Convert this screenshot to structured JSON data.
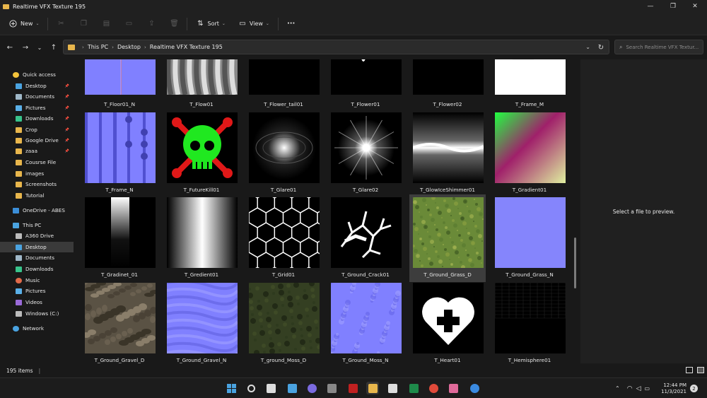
{
  "window": {
    "title": "Realtime VFX Texture 195",
    "minimize_glyph": "—",
    "maximize_glyph": "❐",
    "close_glyph": "✕"
  },
  "toolbar": {
    "new_label": "New",
    "sort_label": "Sort",
    "view_label": "View",
    "more_glyph": "···"
  },
  "address": {
    "crumbs": [
      "This PC",
      "Desktop",
      "Realtime VFX Texture 195"
    ],
    "search_placeholder": "Search Realtime VFX Textur..."
  },
  "sidebar": {
    "items": [
      {
        "label": "Quick access",
        "icon": "star-icon",
        "color": "#f3c33b",
        "pinned": false,
        "selected": false
      },
      {
        "label": "Desktop",
        "icon": "desktop-icon",
        "color": "#4aa3e0",
        "pinned": true,
        "selected": false
      },
      {
        "label": "Documents",
        "icon": "documents-icon",
        "color": "#9fb8c8",
        "pinned": true,
        "selected": false
      },
      {
        "label": "Pictures",
        "icon": "pictures-icon",
        "color": "#5ab0e8",
        "pinned": true,
        "selected": false
      },
      {
        "label": "Downloads",
        "icon": "downloads-icon",
        "color": "#38c38b",
        "pinned": true,
        "selected": false
      },
      {
        "label": "Crop",
        "icon": "folder-icon",
        "color": "#e8b64c",
        "pinned": true,
        "selected": false
      },
      {
        "label": "Google Drive",
        "icon": "folder-icon",
        "color": "#e8b64c",
        "pinned": true,
        "selected": false
      },
      {
        "label": "zaaa",
        "icon": "folder-icon",
        "color": "#e8b64c",
        "pinned": true,
        "selected": false
      },
      {
        "label": "Cousrse File",
        "icon": "folder-icon",
        "color": "#e8b64c",
        "pinned": false,
        "selected": false
      },
      {
        "label": "images",
        "icon": "folder-icon",
        "color": "#e8b64c",
        "pinned": false,
        "selected": false
      },
      {
        "label": "Screenshots",
        "icon": "folder-icon",
        "color": "#e8b64c",
        "pinned": false,
        "selected": false
      },
      {
        "label": "Tutorial",
        "icon": "folder-icon",
        "color": "#e8b64c",
        "pinned": false,
        "selected": false
      },
      {
        "label": "OneDrive - ABES",
        "icon": "onedrive-icon",
        "color": "#3b8ed8",
        "pinned": false,
        "selected": false
      },
      {
        "label": "This PC",
        "icon": "pc-icon",
        "color": "#4aa3e0",
        "pinned": false,
        "selected": false
      },
      {
        "label": "A360 Drive",
        "icon": "drive-icon",
        "color": "#bcbcbc",
        "pinned": false,
        "selected": false
      },
      {
        "label": "Desktop",
        "icon": "desktop-icon",
        "color": "#4aa3e0",
        "pinned": false,
        "selected": true
      },
      {
        "label": "Documents",
        "icon": "documents-icon",
        "color": "#9fb8c8",
        "pinned": false,
        "selected": false
      },
      {
        "label": "Downloads",
        "icon": "downloads-icon",
        "color": "#38c38b",
        "pinned": false,
        "selected": false
      },
      {
        "label": "Music",
        "icon": "music-icon",
        "color": "#e06a4a",
        "pinned": false,
        "selected": false
      },
      {
        "label": "Pictures",
        "icon": "pictures-icon",
        "color": "#5ab0e8",
        "pinned": false,
        "selected": false
      },
      {
        "label": "Videos",
        "icon": "videos-icon",
        "color": "#9a6ad8",
        "pinned": false,
        "selected": false
      },
      {
        "label": "Windows (C:)",
        "icon": "disk-icon",
        "color": "#bcbcbc",
        "pinned": false,
        "selected": false
      },
      {
        "label": "Network",
        "icon": "network-icon",
        "color": "#4aa3e0",
        "pinned": false,
        "selected": false
      }
    ]
  },
  "files": [
    {
      "name": "T_Floor01_N",
      "thumb": "floor_n"
    },
    {
      "name": "T_Flow01",
      "thumb": "flow"
    },
    {
      "name": "T_Flower_tail01",
      "thumb": "flower_tail"
    },
    {
      "name": "T_Flower01",
      "thumb": "flower01"
    },
    {
      "name": "T_Flower02",
      "thumb": "flower02"
    },
    {
      "name": "T_Frame_M",
      "thumb": "frame_m"
    },
    {
      "name": "T_Frame_N",
      "thumb": "frame_n"
    },
    {
      "name": "T_FutureKill01",
      "thumb": "skull"
    },
    {
      "name": "T_Glare01",
      "thumb": "glare01"
    },
    {
      "name": "T_Glare02",
      "thumb": "glare02"
    },
    {
      "name": "T_GlowIceShimmer01",
      "thumb": "shimmer"
    },
    {
      "name": "T_Gradient01",
      "thumb": "gradient_color"
    },
    {
      "name": "T_Gradinet_01",
      "thumb": "gradinet"
    },
    {
      "name": "T_Gredient01",
      "thumb": "gredient"
    },
    {
      "name": "T_Grid01",
      "thumb": "hexgrid"
    },
    {
      "name": "T_Ground_Crack01",
      "thumb": "crack"
    },
    {
      "name": "T_Ground_Grass_D",
      "thumb": "grass_d",
      "selected": true
    },
    {
      "name": "T_Ground_Grass_N",
      "thumb": "normal_flat"
    },
    {
      "name": "T_Ground_Gravel_D",
      "thumb": "gravel_d"
    },
    {
      "name": "T_Ground_Gravel_N",
      "thumb": "normal_wavy"
    },
    {
      "name": "T_ground_Moss_D",
      "thumb": "moss_d"
    },
    {
      "name": "T_Ground_Moss_N",
      "thumb": "normal_bumpy"
    },
    {
      "name": "T_Heart01",
      "thumb": "heart"
    },
    {
      "name": "T_Hemisphere01",
      "thumb": "hemisphere"
    }
  ],
  "preview": {
    "message": "Select a file to preview."
  },
  "status": {
    "item_count": "195 items"
  },
  "taskbar": {
    "apps": [
      "windows-start-icon",
      "search-icon",
      "task-view-icon",
      "widgets-icon",
      "teams-chat-icon",
      "calculator-icon",
      "app-red-icon",
      "file-explorer-icon",
      "whiteboard-icon",
      "excel-icon",
      "chrome-icon",
      "snip-icon",
      "chrome-profile-icon"
    ],
    "time": "12:44 PM",
    "date": "11/3/2021",
    "notifications": "2"
  },
  "colors": {
    "accent": "#4aa3e0",
    "normal_map": "#8080ff",
    "folder": "#e8b64c"
  }
}
